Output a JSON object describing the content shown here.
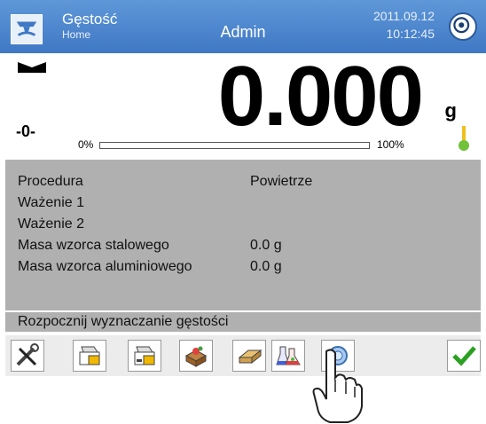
{
  "header": {
    "title": "Gęstość",
    "subtitle": "Home",
    "user": "Admin",
    "date": "2011.09.12",
    "time": "10:12:45"
  },
  "display": {
    "value": "0.000",
    "unit": "g",
    "zero_indicator": "-0-",
    "bar_min_label": "0%",
    "bar_max_label": "100%",
    "load_fraction": 0
  },
  "procedure": {
    "rows": [
      {
        "label": "Procedura",
        "value": "Powietrze"
      },
      {
        "label": "Ważenie 1",
        "value": ""
      },
      {
        "label": "Ważenie 2",
        "value": ""
      },
      {
        "label": "Masa wzorca stalowego",
        "value": "0.0 g"
      },
      {
        "label": "Masa wzorca aluminiowego",
        "value": "0.0 g"
      }
    ]
  },
  "status_text": "Rozpocznij wyznaczanie gęstości",
  "toolbar": {
    "buttons": [
      "tools-icon",
      "print-header-icon",
      "print-footer-icon",
      "sample-icon",
      "eraser-icon",
      "flasks-icon",
      "start-icon",
      "ok-icon"
    ]
  }
}
